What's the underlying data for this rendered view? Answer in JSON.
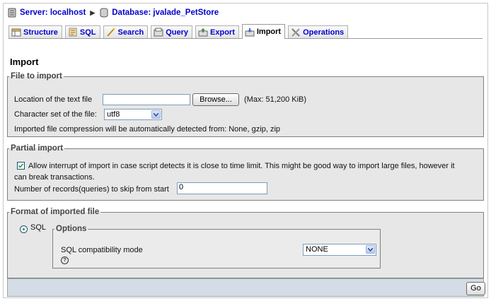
{
  "breadcrumb": {
    "server_label": "Server: localhost",
    "database_label": "Database: jvalade_PetStore"
  },
  "tabs": [
    {
      "label": "Structure",
      "icon": "structure-icon"
    },
    {
      "label": "SQL",
      "icon": "sql-icon"
    },
    {
      "label": "Search",
      "icon": "search-icon"
    },
    {
      "label": "Query",
      "icon": "query-icon"
    },
    {
      "label": "Export",
      "icon": "export-icon"
    },
    {
      "label": "Import",
      "icon": "import-icon",
      "active": true
    },
    {
      "label": "Operations",
      "icon": "operations-icon"
    }
  ],
  "page_title": "Import",
  "file_to_import": {
    "legend": "File to import",
    "location_label": "Location of the text file",
    "location_value": "",
    "browse_label": "Browse...",
    "max_label": "(Max: 51,200 KiB)",
    "charset_label": "Character set of the file:",
    "charset_value": "utf8",
    "compression_note": "Imported file compression will be automatically detected from: None, gzip, zip"
  },
  "partial_import": {
    "legend": "Partial import",
    "allow_interrupt_checked": true,
    "allow_interrupt_label_line1": "Allow interrupt of import in case script detects it is close to time limit. This might be good way to import large files, however it",
    "allow_interrupt_label_line2": "can break transactions.",
    "skip_label": "Number of records(queries) to skip from start",
    "skip_value": "0"
  },
  "format": {
    "legend": "Format of imported file",
    "sql_label": "SQL",
    "sql_selected": true,
    "options_legend": "Options",
    "compat_label": "SQL compatibility mode",
    "compat_value": "NONE"
  },
  "go_label": "Go",
  "colors": {
    "link": "#0000cc",
    "panel": "#e7e7e7",
    "footer": "#d4dce6"
  }
}
